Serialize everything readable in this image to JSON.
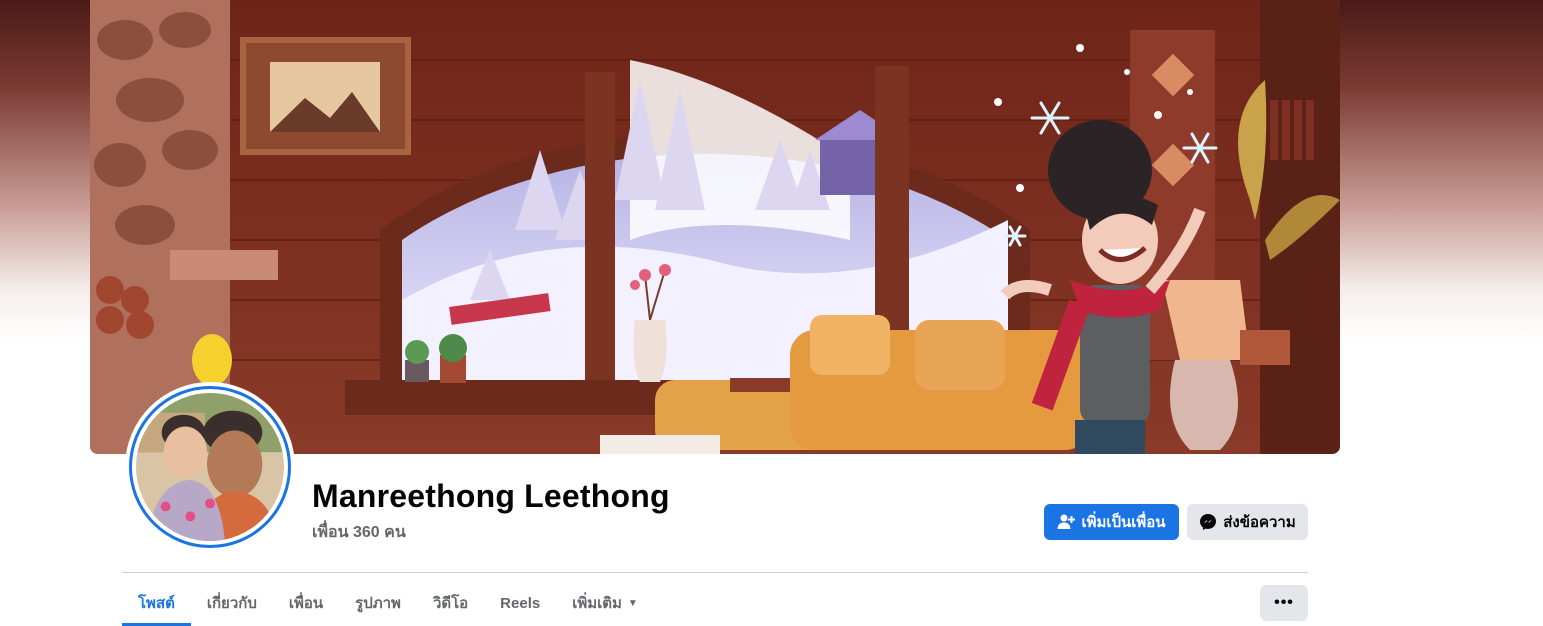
{
  "profile": {
    "name": "Manreethong Leethong",
    "friends_count": "เพื่อน 360 คน"
  },
  "actions": {
    "add_friend_label": "เพิ่มเป็นเพื่อน",
    "message_label": "ส่งข้อความ"
  },
  "tabs": [
    {
      "label": "โพสต์",
      "active": true
    },
    {
      "label": "เกี่ยวกับ",
      "active": false
    },
    {
      "label": "เพื่อน",
      "active": false
    },
    {
      "label": "รูปภาพ",
      "active": false
    },
    {
      "label": "วิดีโอ",
      "active": false
    },
    {
      "label": "Reels",
      "active": false
    },
    {
      "label": "เพิ่มเติม",
      "active": false
    }
  ],
  "more_button_label": "•••",
  "icons": {
    "add_friend": "person-plus-icon",
    "message": "messenger-icon",
    "more_caret": "caret-down-icon"
  },
  "colors": {
    "accent": "#1b74e4",
    "secondary_button": "#e4e6eb",
    "text_primary": "#050505",
    "text_secondary": "#65676b"
  }
}
